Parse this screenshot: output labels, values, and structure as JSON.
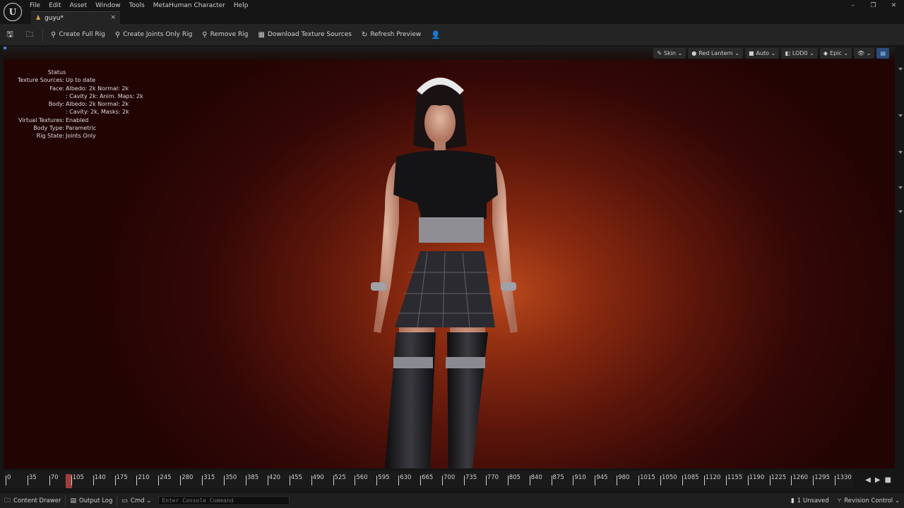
{
  "app": {
    "logo": "U"
  },
  "menu": [
    "File",
    "Edit",
    "Asset",
    "Window",
    "Tools",
    "MetaHuman Character",
    "Help"
  ],
  "tab": {
    "label": "guyu*",
    "icon": "metahuman-icon",
    "close": "×"
  },
  "window_controls": {
    "minimize": "–",
    "maximize": "❐",
    "close": "✕"
  },
  "toolbar": {
    "create_full_rig": "Create Full Rig",
    "create_joints_only_rig": "Create Joints Only Rig",
    "remove_rig": "Remove Rig",
    "download_texture_sources": "Download Texture Sources",
    "refresh_preview": "Refresh Preview"
  },
  "viewport_options": {
    "skin": "Skin",
    "lighting": "Red Lantern",
    "lod_mode": "Auto",
    "lod": "LOD0",
    "quality": "Epic"
  },
  "status_panel": {
    "header": "Status",
    "rows": [
      {
        "key": "Texture Sources:",
        "value": "Up to date"
      },
      {
        "key": "Face:",
        "value": "Albedo: 2k Normal: 2k"
      },
      {
        "key": "",
        "value": ": Cavity 2k: Anim. Maps: 2k"
      },
      {
        "key": "Body:",
        "value": "Albedo: 2k Normal: 2k"
      },
      {
        "key": "",
        "value": ": Cavity: 2k, Masks: 2k"
      },
      {
        "key": "Virtual Textures:",
        "value": "Enabled"
      },
      {
        "key": "Body Type:",
        "value": "Parametric"
      },
      {
        "key": "Rig State:",
        "value": "Joints Only"
      }
    ]
  },
  "timeline": {
    "ticks": [
      "0",
      "35",
      "70",
      "105",
      "140",
      "175",
      "210",
      "245",
      "280",
      "315",
      "350",
      "385",
      "420",
      "455",
      "490",
      "525",
      "560",
      "595",
      "630",
      "665",
      "700",
      "735",
      "770",
      "805",
      "840",
      "875",
      "910",
      "945",
      "980",
      "1015",
      "1050",
      "1085",
      "1120",
      "1155",
      "1190",
      "1225",
      "1260",
      "1295",
      "1330"
    ]
  },
  "statusbar": {
    "content_drawer": "Content Drawer",
    "output_log": "Output Log",
    "cmd": "Cmd",
    "console_placeholder": "Enter Console Command",
    "unsaved": "1 Unsaved",
    "revision_control": "Revision Control"
  },
  "colors": {
    "accent": "#2b4b7a",
    "playhead": "#a33b3b",
    "viewport_bg": "#8a2a10"
  }
}
